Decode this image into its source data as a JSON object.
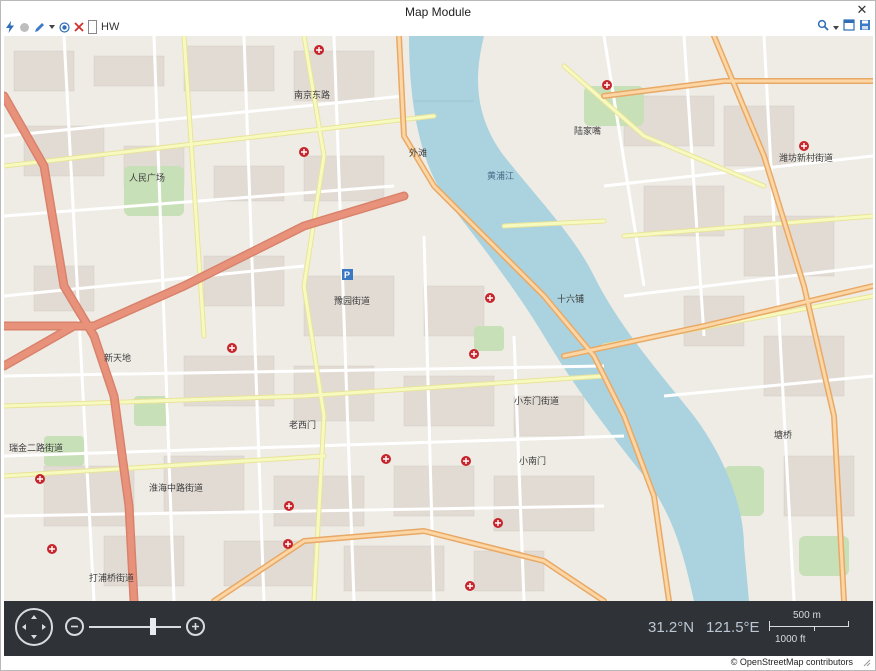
{
  "window": {
    "title": "Map Module",
    "close_glyph": "✕"
  },
  "toolbar": {
    "icons": [
      "lightning-icon",
      "circle-icon",
      "pen-icon",
      "dropdown-caret-icon",
      "radio-target-icon",
      "delete-x-icon"
    ],
    "hw_checkbox_label": "HW",
    "hw_checked": false,
    "right_icons": [
      "search-icon",
      "dropdown-caret-icon",
      "window-icon",
      "save-icon"
    ]
  },
  "map": {
    "labels": {
      "district_1": "人民广场",
      "district_2": "豫园街道",
      "district_3": "小东门街道",
      "district_4": "老西门",
      "district_5": "淮海中路街道",
      "district_6": "打浦桥街道",
      "district_7": "外滩",
      "district_8": "南京东路",
      "district_9": "陆家嘴",
      "district_10": "潍坊新村街道",
      "district_11": "塘桥",
      "district_12": "黄浦江",
      "district_13": "瑞金二路街道",
      "district_14": "新天地",
      "district_15": "小南门",
      "district_16": "十六铺"
    },
    "colors": {
      "land": "#efece6",
      "water": "#aad3df",
      "major_road": "#e8927c",
      "secondary_road": "#f7fabf",
      "tertiary_road": "#fcd6a4",
      "park": "#c8e0b7",
      "building": "#d9d0c9"
    }
  },
  "controls": {
    "latitude": "31.2°N",
    "longitude": "121.5°E",
    "scale_metric": "500 m",
    "scale_imperial": "1000 ft",
    "zoom_level_fraction": 0.7,
    "icons": [
      "pan-navigation-icon",
      "zoom-out-icon",
      "zoom-in-icon"
    ]
  },
  "attribution": "© OpenStreetMap contributors"
}
